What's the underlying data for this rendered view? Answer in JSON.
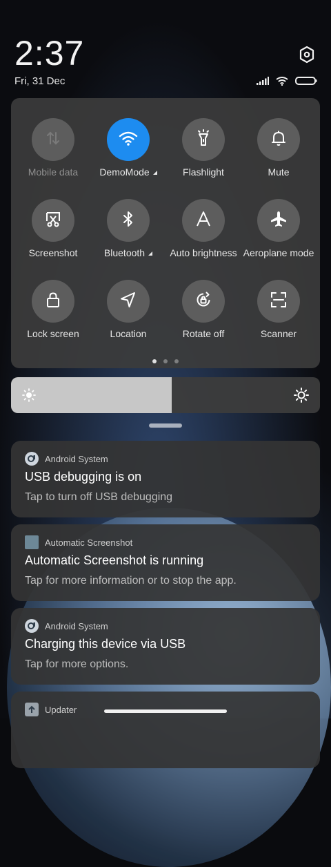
{
  "header": {
    "time": "2:37",
    "date": "Fri, 31 Dec"
  },
  "quick_settings": {
    "tiles": [
      {
        "label": "Mobile data",
        "icon": "mobile-data-icon",
        "active": false,
        "dim": true,
        "caret": false
      },
      {
        "label": "DemoMode",
        "icon": "wifi-icon",
        "active": true,
        "dim": false,
        "caret": true
      },
      {
        "label": "Flashlight",
        "icon": "flashlight-icon",
        "active": false,
        "dim": false,
        "caret": false
      },
      {
        "label": "Mute",
        "icon": "bell-icon",
        "active": false,
        "dim": false,
        "caret": false
      },
      {
        "label": "Screenshot",
        "icon": "screenshot-icon",
        "active": false,
        "dim": false,
        "caret": false
      },
      {
        "label": "Bluetooth",
        "icon": "bluetooth-icon",
        "active": false,
        "dim": false,
        "caret": true
      },
      {
        "label": "Auto brightness",
        "icon": "auto-brightness-icon",
        "active": false,
        "dim": false,
        "caret": false
      },
      {
        "label": "Aeroplane mode",
        "icon": "airplane-icon",
        "active": false,
        "dim": false,
        "caret": false
      },
      {
        "label": "Lock screen",
        "icon": "lock-icon",
        "active": false,
        "dim": false,
        "caret": false
      },
      {
        "label": "Location",
        "icon": "location-icon",
        "active": false,
        "dim": false,
        "caret": false
      },
      {
        "label": "Rotate off",
        "icon": "rotate-lock-icon",
        "active": false,
        "dim": false,
        "caret": false
      },
      {
        "label": "Scanner",
        "icon": "scanner-icon",
        "active": false,
        "dim": false,
        "caret": false
      }
    ],
    "page_count": 3,
    "active_page": 1
  },
  "brightness": {
    "level": 0.52
  },
  "notifications": [
    {
      "app": "Android System",
      "icon": "android-system-icon",
      "title": "USB debugging is on",
      "body": "Tap to turn off USB debugging"
    },
    {
      "app": "Automatic Screenshot",
      "icon": "automatic-screenshot-icon",
      "title": "Automatic Screenshot is running",
      "body": "Tap for more information or to stop the app."
    },
    {
      "app": "Android System",
      "icon": "android-system-icon",
      "title": "Charging this device via USB",
      "body": "Tap for more options."
    },
    {
      "app": "Updater",
      "icon": "updater-icon",
      "title": "",
      "body": ""
    }
  ],
  "colors": {
    "accent": "#1d8cf0",
    "panel": "#3c3c3c"
  }
}
